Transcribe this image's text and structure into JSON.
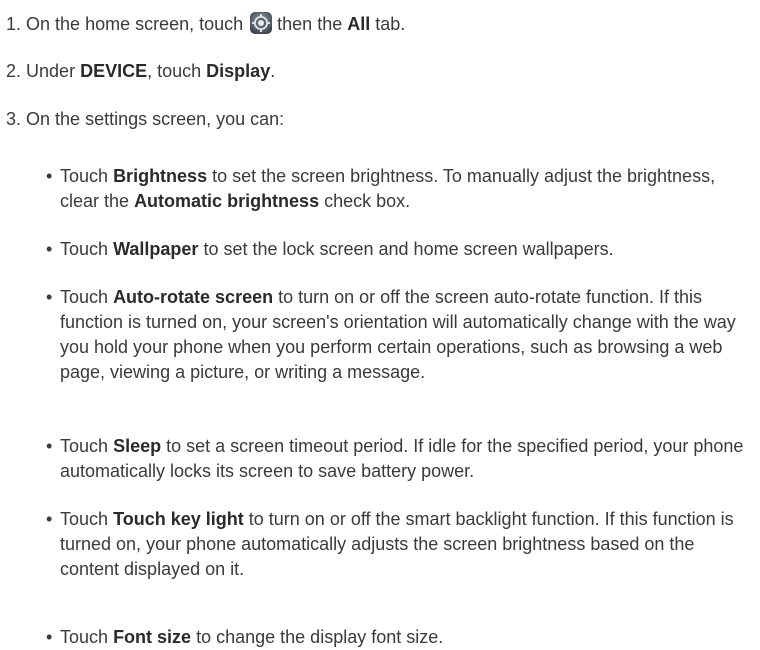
{
  "steps": [
    {
      "number": "1.",
      "text_a": "On the home screen, touch",
      "icon": "settings-gear-icon",
      "text_b": "then the",
      "bold_1": "All",
      "text_c": "tab."
    },
    {
      "number": "2.",
      "text_a": "Under",
      "bold_1": "DEVICE",
      "text_b": ", touch",
      "bold_2": "Display",
      "text_c": "."
    },
    {
      "number": "3.",
      "text_a": "On the settings screen, you can:"
    }
  ],
  "bullets": [
    {
      "marker": "•",
      "lead": "Touch",
      "bold_1": "Brightness",
      "mid": "to set the screen brightness. To manually adjust the brightness, clear the",
      "bold_2": "Automatic brightness",
      "tail": "check box."
    },
    {
      "marker": "•",
      "lead": "Touch",
      "bold_1": "Wallpaper",
      "mid": "to set the lock screen and home screen wallpapers."
    },
    {
      "marker": "•",
      "lead": "Touch",
      "bold_1": "Auto-rotate screen",
      "mid": "to turn on or off the screen auto-rotate function. If this function is turned on, your screen's orientation will automatically change with the way you hold your phone when you perform certain operations, such as browsing a web page, viewing a picture, or writing a message."
    },
    {
      "marker": "•",
      "lead": "Touch",
      "bold_1": "Sleep",
      "mid": "to set a screen timeout period. If idle for the specified period, your phone automatically locks its screen to save battery power."
    },
    {
      "marker": "•",
      "lead": "Touch",
      "bold_1": "Touch key light",
      "mid": "to turn on or off the smart backlight function. If this function is turned on, your phone automatically adjusts the screen brightness based on the content displayed on it."
    },
    {
      "marker": "•",
      "lead": "Touch",
      "bold_1": "Font size",
      "mid": "to change the display font size."
    }
  ]
}
